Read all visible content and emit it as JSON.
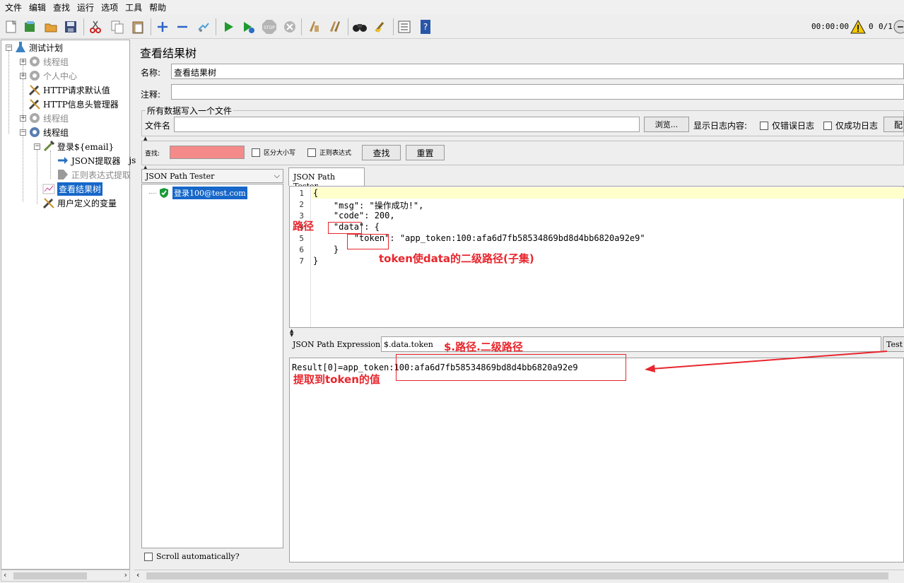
{
  "menu": [
    "文件",
    "编辑",
    "查找",
    "运行",
    "选项",
    "工具",
    "帮助"
  ],
  "toolbar": {
    "timer": "00:00:00",
    "warnings": "0",
    "threads": "0/1"
  },
  "tree": {
    "root": "测试计划",
    "items": [
      {
        "label": "线程组",
        "disabled": true
      },
      {
        "label": "个人中心",
        "disabled": true
      },
      {
        "label": "HTTP请求默认值"
      },
      {
        "label": "HTTP信息头管理器"
      },
      {
        "label": "线程组",
        "disabled": true
      },
      {
        "label": "线程组"
      },
      {
        "label": "登录${email}"
      },
      {
        "label": "JSON提取器",
        "suffix": "js"
      },
      {
        "label": "正则表达式提取",
        "disabled": true
      },
      {
        "label": "查看结果树",
        "selected": true
      },
      {
        "label": "用户定义的变量"
      }
    ]
  },
  "panel": {
    "title": "查看结果树",
    "name_label": "名称:",
    "name_value": "查看结果树",
    "comment_label": "注释:",
    "comment_value": "",
    "file_group_title": "所有数据写入一个文件",
    "filename_label": "文件名",
    "filename_value": "",
    "browse_label": "浏览...",
    "log_label": "显示日志内容:",
    "errors_only_label": "仅错误日志",
    "success_only_label": "仅成功日志",
    "configure_label": "配"
  },
  "search": {
    "label": "查找:",
    "value": "",
    "case_label": "区分大小写",
    "regex_label": "正则表达式",
    "find_label": "查找",
    "reset_label": "重置",
    "field_color": "#f58a8a"
  },
  "renderer": {
    "selected": "JSON Path Tester",
    "sample": "登录100@test.com",
    "scroll_auto": "Scroll automatically?"
  },
  "tester": {
    "tab": "JSON Path Tester",
    "line_numbers": [
      "1",
      "2",
      "3",
      "4",
      "5",
      "6",
      "7"
    ],
    "code_lines": [
      "{",
      "    \"msg\": \"操作成功!\",",
      "    \"code\": 200,",
      "    \"data\": {",
      "        \"token\": \"app_token:100:afa6d7fb58534869bd8d4bb6820a92e9\"",
      "    }",
      "}"
    ],
    "expr_label": "JSON Path Expression",
    "expr_value": "$.data.token",
    "test_label": "Test",
    "result": "Result[0]=app_token:100:afa6d7fb58534869bd8d4bb6820a92e9"
  },
  "annotations": {
    "path": "路径",
    "subpath": "token使data的二级路径(子集)",
    "expr_note": "$.路径.二级路径",
    "value_note": "提取到token的值",
    "color": "#e8262d"
  }
}
